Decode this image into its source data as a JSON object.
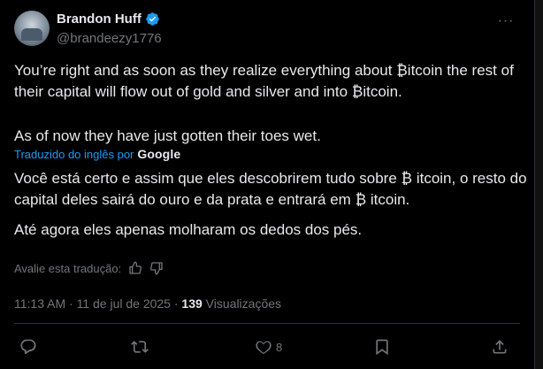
{
  "author": {
    "display_name": "Brandon Huff",
    "handle": "@brandeezy1776",
    "verified_icon": "verified-badge-icon"
  },
  "tweet": {
    "paragraph1": "You’re right and as soon as they realize everything about ₿itcoin the rest of their capital will flow out of gold and silver and into ₿itcoin.",
    "paragraph2": "As of now they have just gotten their toes wet."
  },
  "translation": {
    "label": "Traduzido do inglês por",
    "provider": "Google",
    "paragraph1": "Você está certo e assim que eles descobrirem tudo sobre ₿ itcoin, o resto do capital deles sairá do ouro e da prata e entrará em ₿ itcoin.",
    "paragraph2": "Até agora eles apenas molharam os dedos dos pés.",
    "rate_label": "Avalie esta tradução:"
  },
  "meta": {
    "time": "11:13 AM",
    "separator1": "·",
    "date": "11 de jul de 2025",
    "separator2": "·",
    "views_count": "139",
    "views_label": "Visualizações"
  },
  "actions": {
    "reply_count": "",
    "retweet_count": "",
    "like_count": "8",
    "bookmark_count": ""
  },
  "colors": {
    "background": "#000000",
    "text": "#e7e9ea",
    "muted": "#71767b",
    "link": "#1d9bf0",
    "verified": "#1d9bf0"
  }
}
